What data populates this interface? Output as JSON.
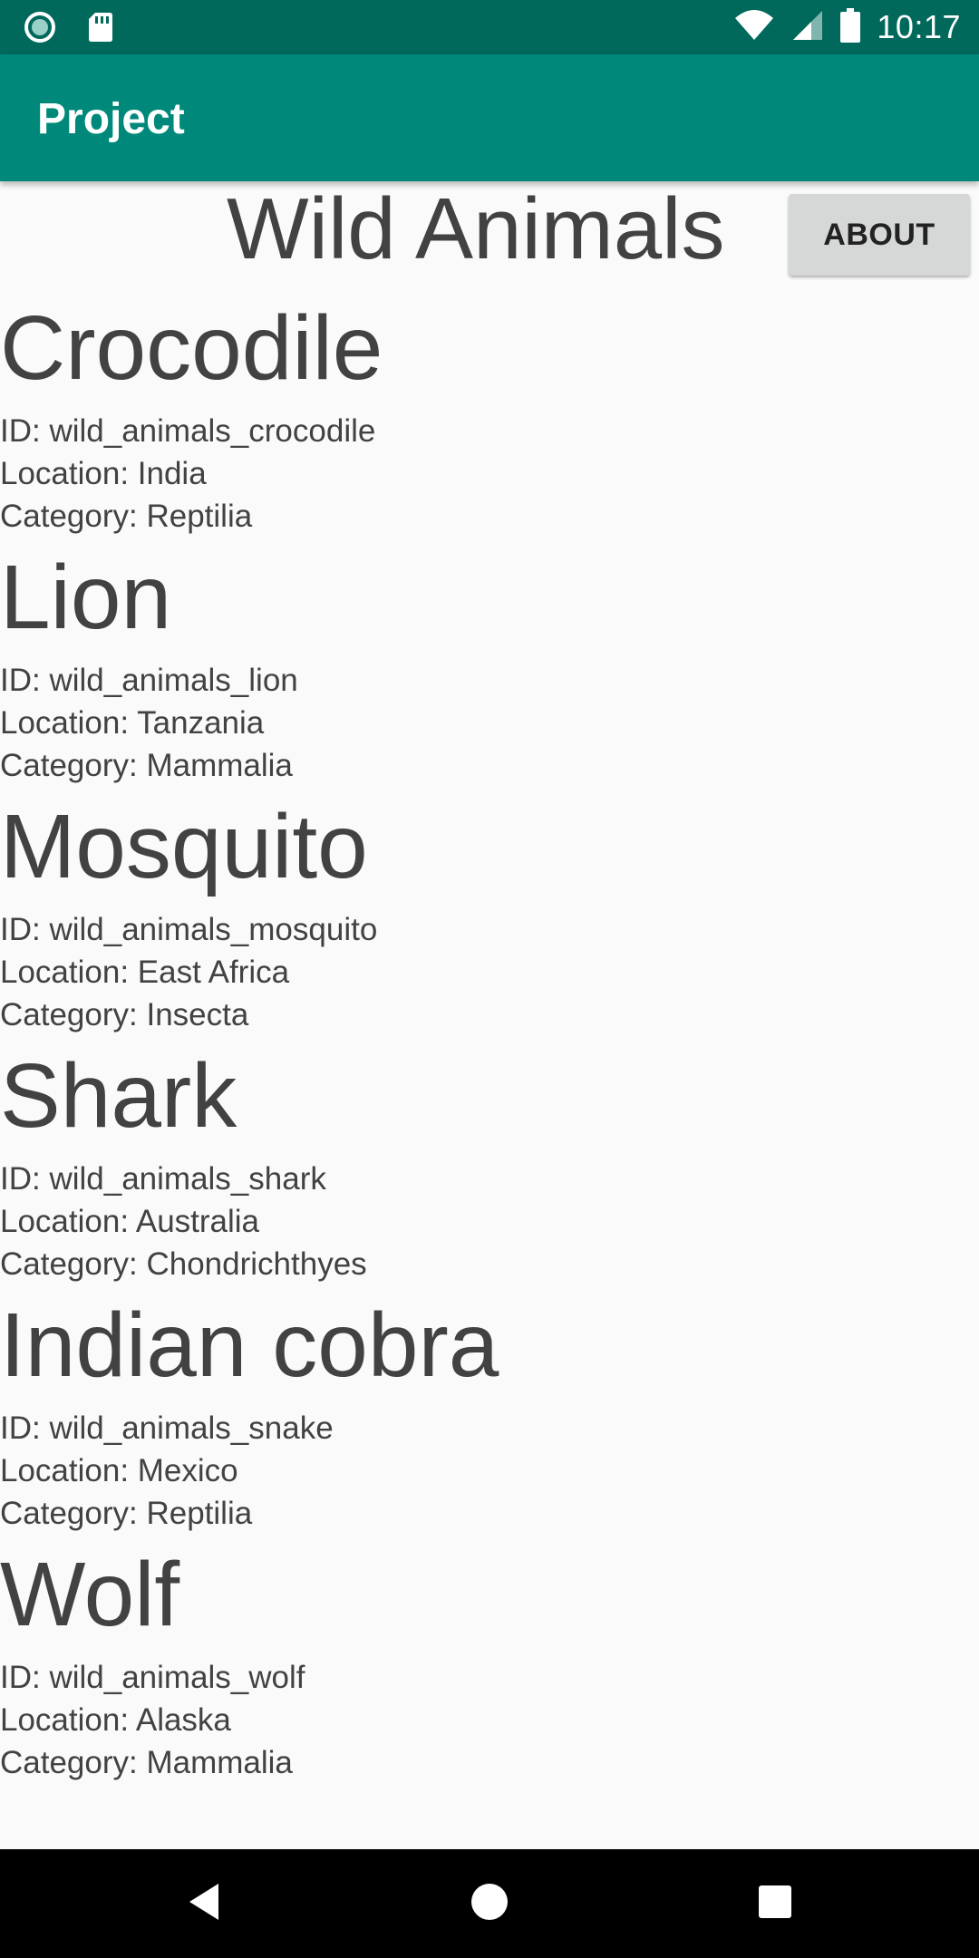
{
  "status_bar": {
    "time": "10:17",
    "left_icons": [
      "record-icon",
      "sd-card-icon"
    ],
    "right_icons": [
      "wifi-icon",
      "signal-icon",
      "battery-icon"
    ]
  },
  "app_bar": {
    "title": "Project"
  },
  "page": {
    "title": "Wild Animals",
    "about_label": "ABOUT"
  },
  "animals": [
    {
      "name": "Crocodile",
      "id_line": "ID: wild_animals_crocodile",
      "location_line": "Location: India",
      "category_line": "Category: Reptilia"
    },
    {
      "name": "Lion",
      "id_line": "ID: wild_animals_lion",
      "location_line": "Location: Tanzania",
      "category_line": "Category: Mammalia"
    },
    {
      "name": "Mosquito",
      "id_line": "ID: wild_animals_mosquito",
      "location_line": "Location: East Africa",
      "category_line": "Category: Insecta"
    },
    {
      "name": "Shark",
      "id_line": "ID: wild_animals_shark",
      "location_line": "Location: Australia",
      "category_line": "Category: Chondrichthyes"
    },
    {
      "name": "Indian cobra",
      "id_line": "ID: wild_animals_snake",
      "location_line": "Location: Mexico",
      "category_line": "Category: Reptilia"
    },
    {
      "name": "Wolf",
      "id_line": "ID: wild_animals_wolf",
      "location_line": "Location: Alaska",
      "category_line": "Category: Mammalia"
    }
  ],
  "nav_bar": {
    "icons": [
      "back-icon",
      "home-icon",
      "recents-icon"
    ]
  },
  "colors": {
    "status_bar": "#00695c",
    "app_bar": "#00897b",
    "background": "#fafafa",
    "text": "#424242",
    "button": "#d6d7d7"
  }
}
